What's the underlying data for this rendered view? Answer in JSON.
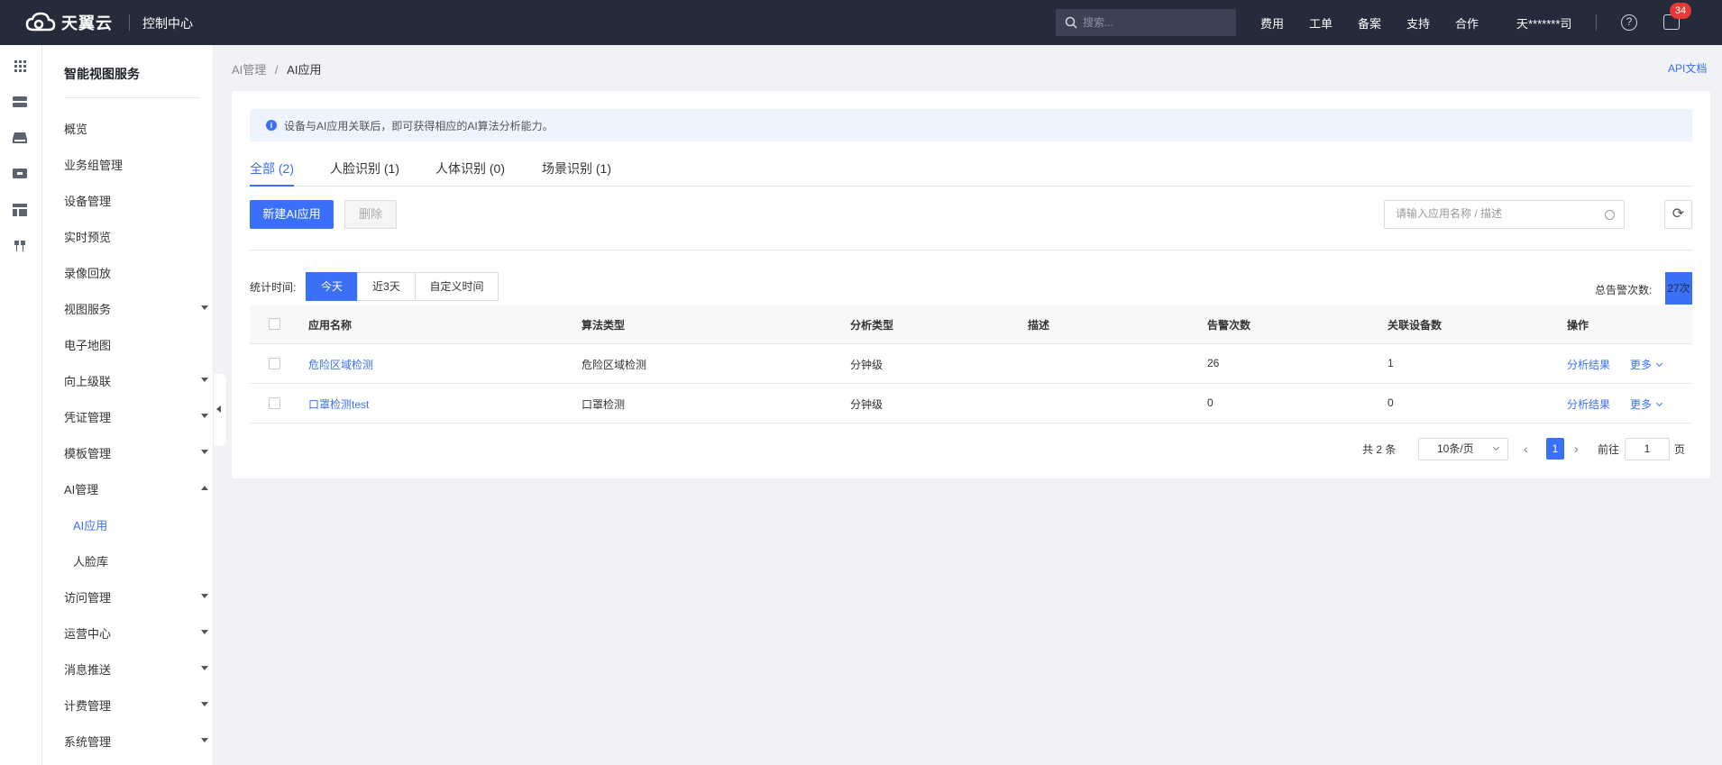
{
  "header": {
    "logo_text": "天翼云",
    "console_title": "控制中心",
    "search_placeholder": "搜索...",
    "nav": [
      "费用",
      "工单",
      "备案",
      "支持",
      "合作"
    ],
    "user_name": "天*******司",
    "help_glyph": "?",
    "msg_badge": "34"
  },
  "sidebar": {
    "title": "智能视图服务",
    "items": [
      {
        "label": "概览"
      },
      {
        "label": "业务组管理"
      },
      {
        "label": "设备管理"
      },
      {
        "label": "实时预览"
      },
      {
        "label": "录像回放"
      },
      {
        "label": "视图服务"
      },
      {
        "label": "电子地图"
      },
      {
        "label": "向上级联"
      },
      {
        "label": "凭证管理"
      },
      {
        "label": "模板管理"
      },
      {
        "label": "AI管理"
      },
      {
        "label": "AI应用"
      },
      {
        "label": "人脸库"
      },
      {
        "label": "访问管理"
      },
      {
        "label": "运营中心"
      },
      {
        "label": "消息推送"
      },
      {
        "label": "计费管理"
      },
      {
        "label": "系统管理"
      }
    ]
  },
  "breadcrumb": {
    "parent": "AI管理",
    "sep": "/",
    "current": "AI应用"
  },
  "api_doc": "API文档",
  "notice": {
    "icon": "i",
    "text": "设备与AI应用关联后，即可获得相应的AI算法分析能力。"
  },
  "tabs": [
    {
      "label": "全部 (2)"
    },
    {
      "label": "人脸识别 (1)"
    },
    {
      "label": "人体识别 (0)"
    },
    {
      "label": "场景识别 (1)"
    }
  ],
  "toolbar": {
    "new_label": "新建AI应用",
    "delete_label": "删除",
    "search_placeholder": "请输入应用名称 / 描述",
    "refresh_glyph": "⟳"
  },
  "stats": {
    "label": "统计时间:",
    "options": [
      "今天",
      "近3天",
      "自定义时间"
    ],
    "selected": "今天",
    "total_label": "总告警次数:",
    "total_value": "27次"
  },
  "table": {
    "columns": [
      "应用名称",
      "算法类型",
      "分析类型",
      "描述",
      "告警次数",
      "关联设备数",
      "操作"
    ],
    "rows": [
      {
        "name": "危险区域检测",
        "algo": "危险区域检测",
        "analysis": "分钟级",
        "desc": "",
        "alarms": "26",
        "devices": "1",
        "action": "分析结果",
        "more": "更多"
      },
      {
        "name": "口罩检测test",
        "algo": "口罩检测",
        "analysis": "分钟级",
        "desc": "",
        "alarms": "0",
        "devices": "0",
        "action": "分析结果",
        "more": "更多"
      }
    ]
  },
  "pagination": {
    "total": "共 2 条",
    "page_size": "10条/页",
    "prev": "‹",
    "current_page": "1",
    "next": "›",
    "goto_label": "前往",
    "goto_value": "1",
    "page_suffix": "页"
  }
}
